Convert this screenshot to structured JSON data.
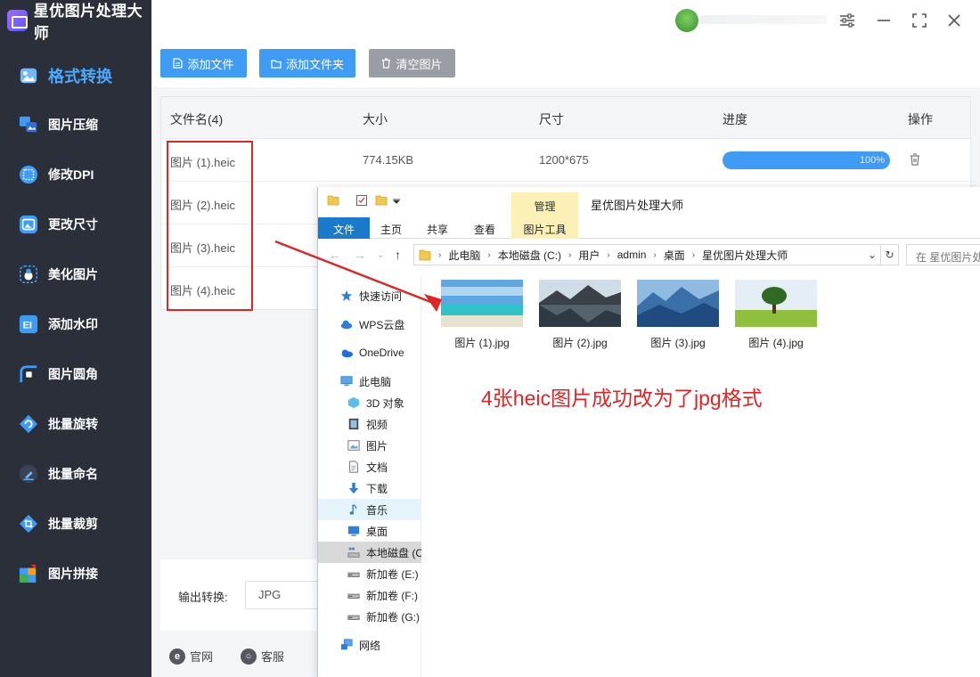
{
  "app": {
    "title": "星优图片处理大师",
    "accent_color": "#3e9cf5",
    "sidebar_bg": "#2b2f3a"
  },
  "sidebar": {
    "items": [
      {
        "label": "格式转换",
        "icon": "format-convert-icon",
        "active": true
      },
      {
        "label": "图片压缩",
        "icon": "image-compress-icon"
      },
      {
        "label": "修改DPI",
        "icon": "dpi-icon"
      },
      {
        "label": "更改尺寸",
        "icon": "resize-icon"
      },
      {
        "label": "美化图片",
        "icon": "beautify-icon"
      },
      {
        "label": "添加水印",
        "icon": "watermark-icon"
      },
      {
        "label": "图片圆角",
        "icon": "round-corner-icon"
      },
      {
        "label": "批量旋转",
        "icon": "rotate-icon"
      },
      {
        "label": "批量命名",
        "icon": "rename-icon"
      },
      {
        "label": "批量裁剪",
        "icon": "crop-icon"
      },
      {
        "label": "图片拼接",
        "icon": "stitch-icon"
      }
    ]
  },
  "toolbar": {
    "add_file": "添加文件",
    "add_folder": "添加文件夹",
    "clear": "清空图片"
  },
  "table": {
    "headers": [
      "文件名(4)",
      "大小",
      "尺寸",
      "进度",
      "操作"
    ],
    "rows": [
      {
        "name": "图片 (1).heic",
        "size": "774.15KB",
        "dims": "1200*675",
        "progress": "100%"
      },
      {
        "name": "图片 (2).heic"
      },
      {
        "name": "图片 (3).heic"
      },
      {
        "name": "图片 (4).heic"
      }
    ]
  },
  "output": {
    "label": "输出转换:",
    "format": "JPG"
  },
  "footer": {
    "website": "官网",
    "support": "客服"
  },
  "explorer": {
    "manage_tab": "管理",
    "window_title": "星优图片处理大师",
    "ribbon_tabs": [
      "文件",
      "主页",
      "共享",
      "查看"
    ],
    "picture_tools": "图片工具",
    "breadcrumbs": [
      "此电脑",
      "本地磁盘 (C:)",
      "用户",
      "admin",
      "桌面",
      "星优图片处理大师"
    ],
    "search_placeholder": "在 星优图片处",
    "nav": [
      {
        "label": "快速访问",
        "icon": "star-icon"
      },
      {
        "label": "WPS云盘",
        "icon": "cloud-icon"
      },
      {
        "label": "OneDrive",
        "icon": "onedrive-icon"
      },
      {
        "label": "此电脑",
        "icon": "computer-icon"
      },
      {
        "label": "3D 对象",
        "icon": "cube-icon"
      },
      {
        "label": "视频",
        "icon": "video-icon"
      },
      {
        "label": "图片",
        "icon": "picture-icon"
      },
      {
        "label": "文档",
        "icon": "document-icon"
      },
      {
        "label": "下载",
        "icon": "download-icon"
      },
      {
        "label": "音乐",
        "icon": "music-icon"
      },
      {
        "label": "桌面",
        "icon": "desktop-icon"
      },
      {
        "label": "本地磁盘 (C",
        "icon": "drive-icon"
      },
      {
        "label": "新加卷 (E:)",
        "icon": "drive-icon"
      },
      {
        "label": "新加卷 (F:)",
        "icon": "drive-icon"
      },
      {
        "label": "新加卷 (G:)",
        "icon": "drive-icon"
      },
      {
        "label": "网络",
        "icon": "network-icon"
      }
    ],
    "files": [
      "图片 (1).jpg",
      "图片 (2).jpg",
      "图片 (3).jpg",
      "图片 (4).jpg"
    ]
  },
  "annotation": {
    "text": "4张heic图片成功改为了jpg格式",
    "color": "#e02525"
  }
}
